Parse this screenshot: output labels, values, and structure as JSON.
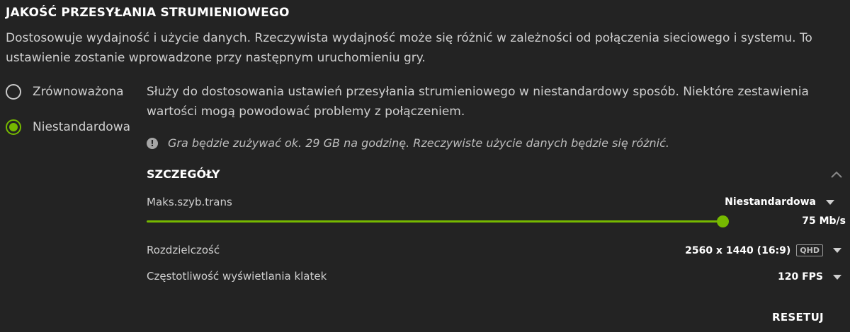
{
  "section": {
    "title": "JAKOŚĆ PRZESYŁANIA STRUMIENIOWEGO",
    "description": "Dostosowuje wydajność i użycie danych. Rzeczywista wydajność może się różnić w zależności od połączenia sieciowego i systemu. To ustawienie zostanie wprowadzone przy następnym uruchomieniu gry."
  },
  "options": [
    {
      "label": "Zrównoważona",
      "selected": false
    },
    {
      "label": "Niestandardowa",
      "selected": true
    }
  ],
  "custom": {
    "description": "Służy do dostosowania ustawień przesyłania strumieniowego w niestandardowy sposób. Niektóre zestawienia wartości mogą powodować problemy z połączeniem.",
    "warning": "Gra będzie zużywać ok. 29 GB na godzinę. Rzeczywiste użycie danych będzie się różnić."
  },
  "details": {
    "title": "SZCZEGÓŁY",
    "bitrate": {
      "label": "Maks.szyb.trans",
      "mode": "Niestandardowa",
      "value": "75 Mb/s",
      "fraction": 1.0
    },
    "resolution": {
      "label": "Rozdzielczość",
      "value": "2560 x 1440 (16:9)",
      "badge": "QHD"
    },
    "framerate": {
      "label": "Częstotliwość wyświetlania klatek",
      "value": "120 FPS"
    }
  },
  "actions": {
    "reset_label": "RESETUJ"
  },
  "colors": {
    "accent": "#76b900",
    "background": "#232323"
  },
  "icons": {
    "warning": "exclamation-circle-icon",
    "collapse": "chevron-up-icon",
    "dropdown": "caret-down-icon"
  }
}
